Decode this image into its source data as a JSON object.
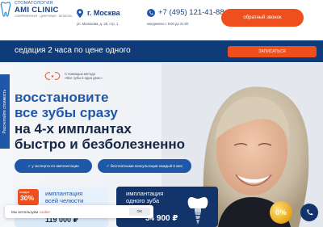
{
  "header": {
    "logo_subtitle": "СТОМАТОЛОГИЯ",
    "logo_name": "AMI CLINIC",
    "logo_tagline": "СОВРЕМЕННАЯ · ЦИФРОВАЯ · БЕЗБОЛЬ",
    "city": "г. Москва",
    "address": "ул. Малахова, д. 26, стр. 1",
    "phone": "+7 (495) 121-41-88",
    "hours": "ежедневно с 9:00 до 21:00",
    "callback_button": "обратный звонок"
  },
  "promo": {
    "text": "седация 2 часа по цене одного",
    "button": "ЗАПИСАТЬСЯ"
  },
  "hero": {
    "cert_text_line1": "С помощью метода",
    "cert_text_line2": "«Все зубы в один день»",
    "headline_1": "восстановите",
    "headline_2": "все зубы сразу",
    "headline_3": "на 4-х имплантах",
    "headline_4": "быстро и безболезненно",
    "pill_1": "✓ у эксперта по имплантации",
    "pill_2": "✓ бесплатными консультации каждый 6 мес",
    "side_tab": "Рассчитайте стоимость"
  },
  "card1": {
    "badge_small": "скидка",
    "badge_big": "30%",
    "title_1": "имплантация",
    "title_2": "всей челюсти",
    "price": "119 000 ₽"
  },
  "card2": {
    "title_1": "имплантация",
    "title_2": "одного зуба",
    "price": "34 900 ₽"
  },
  "cookie": {
    "text": "Мы используем",
    "link": "cookie",
    "ok": "OK"
  },
  "discount_badge": "0%",
  "colors": {
    "navy": "#0f3b78",
    "blue": "#1f58a8",
    "orange": "#ef4f1d"
  }
}
